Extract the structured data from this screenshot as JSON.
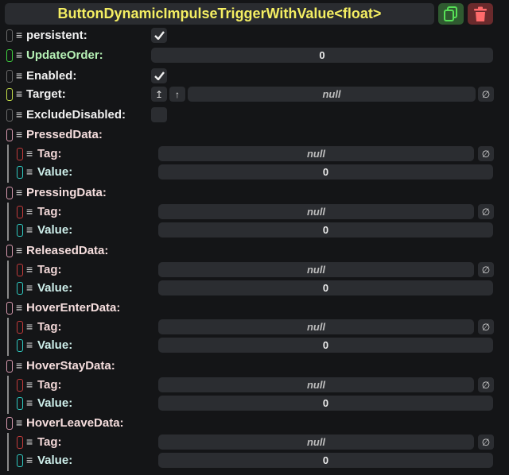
{
  "header": {
    "title": "ButtonDynamicImpulseTriggerWithValue<float>"
  },
  "fields": {
    "persistent": {
      "label": "persistent:",
      "checked": true
    },
    "update_order": {
      "label": "UpdateOrder:",
      "value": "0"
    },
    "enabled": {
      "label": "Enabled:",
      "checked": true
    },
    "target": {
      "label": "Target:",
      "value": "null",
      "clear_glyph": "∅"
    },
    "exclude_disabled": {
      "label": "ExcludeDisabled:",
      "checked": false
    }
  },
  "groups": [
    {
      "label": "PressedData:",
      "tag_label": "Tag:",
      "tag_value": "null",
      "value_label": "Value:",
      "value": "0"
    },
    {
      "label": "PressingData:",
      "tag_label": "Tag:",
      "tag_value": "null",
      "value_label": "Value:",
      "value": "0"
    },
    {
      "label": "ReleasedData:",
      "tag_label": "Tag:",
      "tag_value": "null",
      "value_label": "Value:",
      "value": "0"
    },
    {
      "label": "HoverEnterData:",
      "tag_label": "Tag:",
      "tag_value": "null",
      "value_label": "Value:",
      "value": "0"
    },
    {
      "label": "HoverStayData:",
      "tag_label": "Tag:",
      "tag_value": "null",
      "value_label": "Value:",
      "value": "0"
    },
    {
      "label": "HoverLeaveData:",
      "tag_label": "Tag:",
      "tag_value": "null",
      "value_label": "Value:",
      "value": "0"
    }
  ],
  "glyphs": {
    "hamburger": "≡",
    "null_clear": "∅",
    "up_parent": "↥",
    "up": "↑"
  },
  "colors": {
    "title": "#f4ee62",
    "indicator_default": "#6a6a6a",
    "indicator_green": "#3fd13f",
    "indicator_yellow_green": "#c6e04a",
    "indicator_pink": "#d69aae",
    "indicator_red": "#c33b3b",
    "indicator_cyan": "#2fc9c0"
  }
}
